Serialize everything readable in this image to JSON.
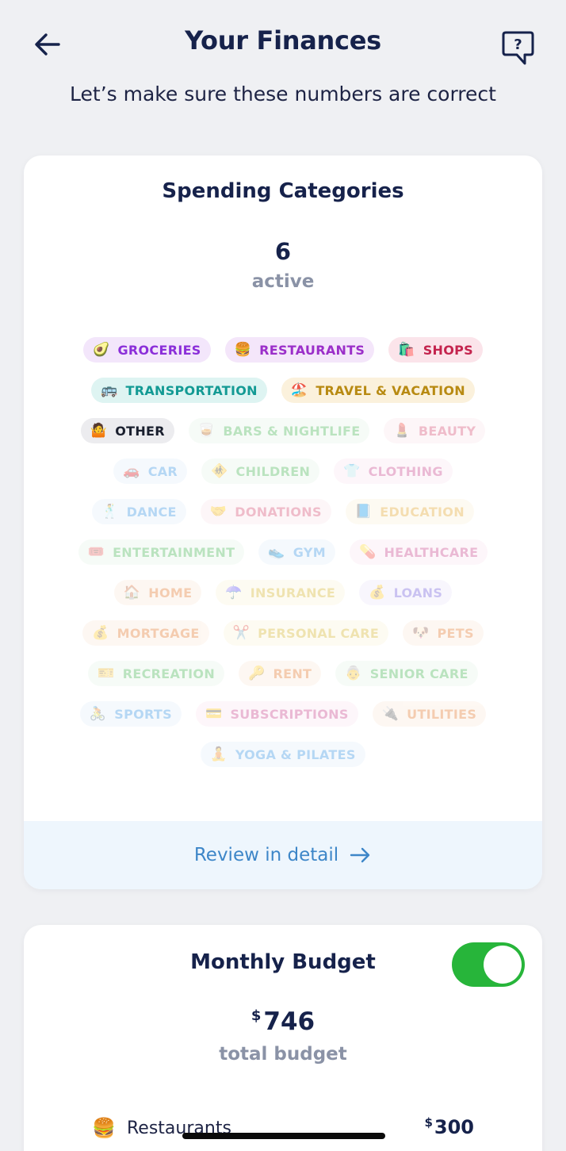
{
  "header": {
    "title": "Your Finances",
    "subtitle": "Let’s make sure these numbers are correct"
  },
  "spending": {
    "title": "Spending Categories",
    "active_count": "6",
    "active_label": "active",
    "tags": [
      {
        "label": "GROCERIES",
        "emoji": "🥑",
        "active": true,
        "color": "#8b2fd9",
        "bg": "#f3e6fb"
      },
      {
        "label": "RESTAURANTS",
        "emoji": "🍔",
        "active": true,
        "color": "#9b2fc9",
        "bg": "#f4e6fa"
      },
      {
        "label": "SHOPS",
        "emoji": "🛍️",
        "active": true,
        "color": "#c4244e",
        "bg": "#fbe4ea"
      },
      {
        "label": "TRANSPORTATION",
        "emoji": "🚌",
        "active": true,
        "color": "#139a94",
        "bg": "#def4f2"
      },
      {
        "label": "TRAVEL & VACATION",
        "emoji": "🏖️",
        "active": true,
        "color": "#b88a12",
        "bg": "#fbf1dc"
      },
      {
        "label": "OTHER",
        "emoji": "🤷",
        "active": true,
        "color": "#1a1f2e",
        "bg": "#ececef"
      },
      {
        "label": "BARS & NIGHTLIFE",
        "emoji": "🥃",
        "active": false,
        "color": "#3bb04a",
        "bg": "#e8f6ea"
      },
      {
        "label": "BEAUTY",
        "emoji": "💄",
        "active": false,
        "color": "#d4426a",
        "bg": "#fbe7ed"
      },
      {
        "label": "CAR",
        "emoji": "🚗",
        "active": false,
        "color": "#2f8ee0",
        "bg": "#e4f0fc"
      },
      {
        "label": "CHILDREN",
        "emoji": "🚸",
        "active": false,
        "color": "#3bb04a",
        "bg": "#e8f6ea"
      },
      {
        "label": "CLOTHING",
        "emoji": "👕",
        "active": false,
        "color": "#c63a86",
        "bg": "#fbe6f1"
      },
      {
        "label": "DANCE",
        "emoji": "🕺",
        "active": false,
        "color": "#2f8ee0",
        "bg": "#e4f0fc"
      },
      {
        "label": "DONATIONS",
        "emoji": "🤝",
        "active": false,
        "color": "#d4426a",
        "bg": "#fbe7ed"
      },
      {
        "label": "EDUCATION",
        "emoji": "📘",
        "active": false,
        "color": "#e0a020",
        "bg": "#fcf2dc"
      },
      {
        "label": "ENTERTAINMENT",
        "emoji": "🎟️",
        "active": false,
        "color": "#3bb04a",
        "bg": "#e8f6ea"
      },
      {
        "label": "GYM",
        "emoji": "👟",
        "active": false,
        "color": "#2f8ee0",
        "bg": "#e4f0fc"
      },
      {
        "label": "HEALTHCARE",
        "emoji": "💊",
        "active": false,
        "color": "#c63a86",
        "bg": "#fbe6f1"
      },
      {
        "label": "HOME",
        "emoji": "🏠",
        "active": false,
        "color": "#e07020",
        "bg": "#fcebdc"
      },
      {
        "label": "INSURANCE",
        "emoji": "☂️",
        "active": false,
        "color": "#d4b020",
        "bg": "#fbf5dc"
      },
      {
        "label": "LOANS",
        "emoji": "💰",
        "active": false,
        "color": "#6a54d8",
        "bg": "#ece8fb"
      },
      {
        "label": "MORTGAGE",
        "emoji": "💰",
        "active": false,
        "color": "#e07020",
        "bg": "#fcebdc"
      },
      {
        "label": "PERSONAL CARE",
        "emoji": "✂️",
        "active": false,
        "color": "#d4b020",
        "bg": "#fbf5dc"
      },
      {
        "label": "PETS",
        "emoji": "🐶",
        "active": false,
        "color": "#e07020",
        "bg": "#fcebdc"
      },
      {
        "label": "RECREATION",
        "emoji": "🎫",
        "active": false,
        "color": "#3bb04a",
        "bg": "#e8f6ea"
      },
      {
        "label": "RENT",
        "emoji": "🔑",
        "active": false,
        "color": "#e07020",
        "bg": "#fcebdc"
      },
      {
        "label": "SENIOR CARE",
        "emoji": "👵",
        "active": false,
        "color": "#3bb04a",
        "bg": "#e8f6ea"
      },
      {
        "label": "SPORTS",
        "emoji": "🚴",
        "active": false,
        "color": "#2f8ee0",
        "bg": "#e4f0fc"
      },
      {
        "label": "SUBSCRIPTIONS",
        "emoji": "💳",
        "active": false,
        "color": "#c63a86",
        "bg": "#fbe6f1"
      },
      {
        "label": "UTILITIES",
        "emoji": "🔌",
        "active": false,
        "color": "#e07020",
        "bg": "#fcebdc"
      },
      {
        "label": "YOGA & PILATES",
        "emoji": "🧘",
        "active": false,
        "color": "#2f8ee0",
        "bg": "#e4f0fc"
      }
    ],
    "review_label": "Review in detail"
  },
  "budget": {
    "title": "Monthly Budget",
    "toggle_on": true,
    "currency": "$",
    "amount": "746",
    "amount_label": "total budget",
    "rows": [
      {
        "emoji": "🍔",
        "name": "Restaurants",
        "currency": "$",
        "value": "300"
      }
    ]
  },
  "colors": {
    "background": "#eff0f3",
    "primary_text": "#16224b",
    "link": "#3d86c8",
    "toggle_on": "#27b53a"
  }
}
